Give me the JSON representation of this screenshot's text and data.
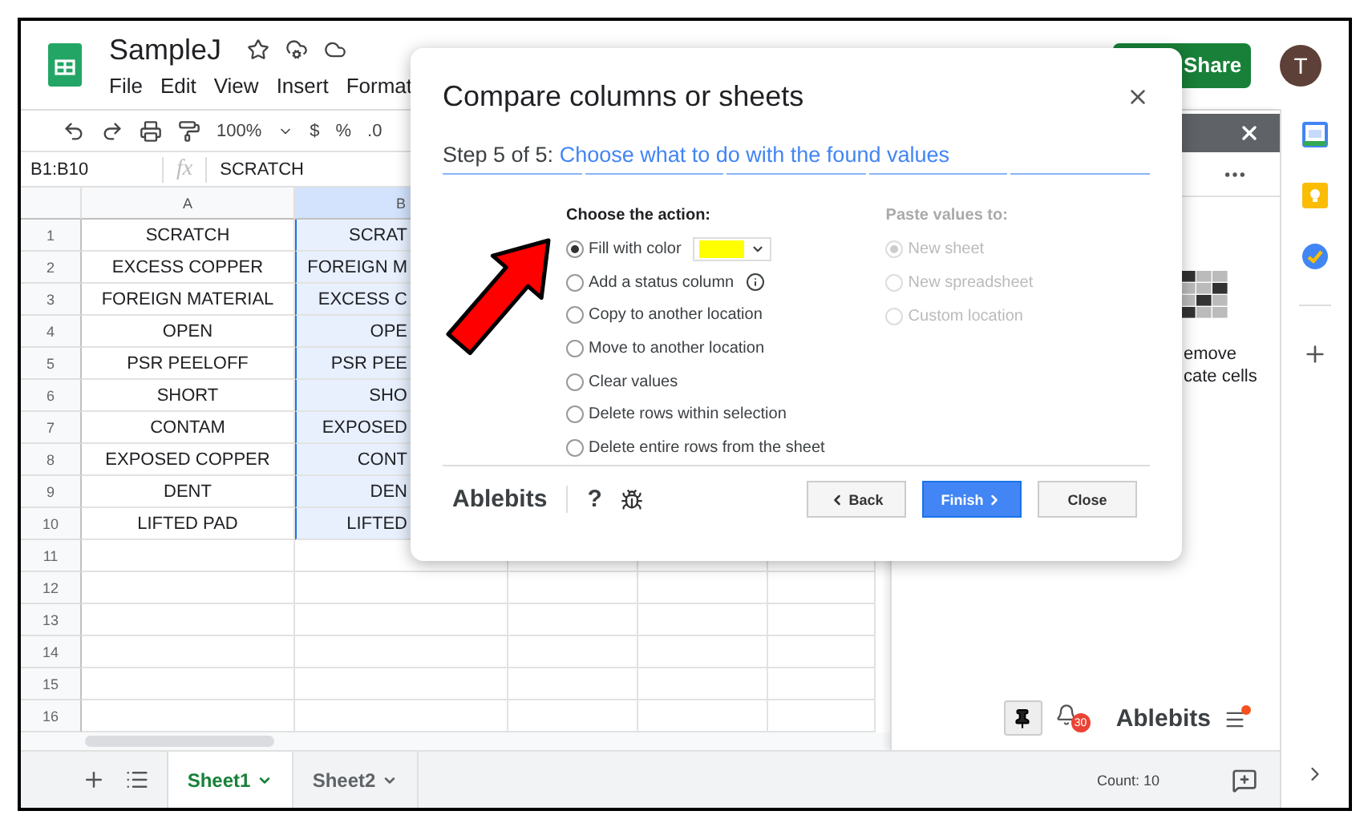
{
  "app": {
    "title": "SampleJ",
    "menu": [
      "File",
      "Edit",
      "View",
      "Insert",
      "Format"
    ],
    "share": "Share",
    "avatar": "T"
  },
  "toolbar": {
    "zoom": "100%",
    "currency": "$",
    "percent": "%",
    "decimal": ".0"
  },
  "formula_bar": {
    "range": "B1:B10",
    "fx": "fx",
    "value": "SCRATCH"
  },
  "grid": {
    "columns": [
      {
        "label": "A",
        "selected": false
      },
      {
        "label": "B",
        "selected": true
      }
    ],
    "rows": [
      {
        "number": "1",
        "cells": [
          "SCRATCH",
          "SCRAT"
        ]
      },
      {
        "number": "2",
        "cells": [
          "EXCESS COPPER",
          "FOREIGN M"
        ]
      },
      {
        "number": "3",
        "cells": [
          "FOREIGN MATERIAL",
          "EXCESS C"
        ]
      },
      {
        "number": "4",
        "cells": [
          "OPEN",
          "OPE"
        ]
      },
      {
        "number": "5",
        "cells": [
          "PSR PEELOFF",
          "PSR PEE"
        ]
      },
      {
        "number": "6",
        "cells": [
          "SHORT",
          "SHO"
        ]
      },
      {
        "number": "7",
        "cells": [
          "CONTAM",
          "EXPOSED"
        ]
      },
      {
        "number": "8",
        "cells": [
          "EXPOSED COPPER",
          "CONT"
        ]
      },
      {
        "number": "9",
        "cells": [
          "DENT",
          "DEN"
        ]
      },
      {
        "number": "10",
        "cells": [
          "LIFTED PAD",
          "LIFTED"
        ]
      },
      {
        "number": "11",
        "cells": [
          "",
          ""
        ]
      },
      {
        "number": "12",
        "cells": [
          "",
          ""
        ]
      },
      {
        "number": "13",
        "cells": [
          "",
          ""
        ]
      },
      {
        "number": "14",
        "cells": [
          "",
          ""
        ]
      },
      {
        "number": "15",
        "cells": [
          "",
          ""
        ]
      },
      {
        "number": "16",
        "cells": [
          "",
          ""
        ]
      }
    ]
  },
  "sheet_tabs": [
    {
      "label": "Sheet1",
      "selected": true
    },
    {
      "label": "Sheet2",
      "selected": false
    }
  ],
  "status": "Count: 10",
  "side_panel": {
    "texts": [
      "emove",
      "cate cells"
    ],
    "notifications": "30",
    "brand": "Ablebits"
  },
  "dialog": {
    "title": "Compare columns or sheets",
    "step_label": "Step 5 of 5:",
    "step_title": "Choose what to do with the found values",
    "action_heading": "Choose the action:",
    "actions": [
      {
        "label": "Fill with color",
        "selected": true,
        "kind": "color",
        "color": "#ffff00"
      },
      {
        "label": "Add a status column",
        "selected": false,
        "kind": "info"
      },
      {
        "label": "Copy to another location",
        "selected": false,
        "kind": "plain"
      },
      {
        "label": "Move to another location",
        "selected": false,
        "kind": "plain"
      },
      {
        "label": "Clear values",
        "selected": false,
        "kind": "plain"
      },
      {
        "label": "Delete rows within selection",
        "selected": false,
        "kind": "plain"
      },
      {
        "label": "Delete entire rows from the sheet",
        "selected": false,
        "kind": "plain"
      }
    ],
    "paste_heading": "Paste values to:",
    "paste_options": [
      {
        "label": "New sheet",
        "selected": true,
        "disabled": true
      },
      {
        "label": "New spreadsheet",
        "selected": false,
        "disabled": true
      },
      {
        "label": "Custom location",
        "selected": false,
        "disabled": true
      }
    ],
    "brand": "Ablebits",
    "help": "?",
    "buttons": [
      {
        "label": "Back",
        "kind": "back"
      },
      {
        "label": "Finish",
        "kind": "primary"
      },
      {
        "label": "Close",
        "kind": "plain"
      }
    ]
  }
}
